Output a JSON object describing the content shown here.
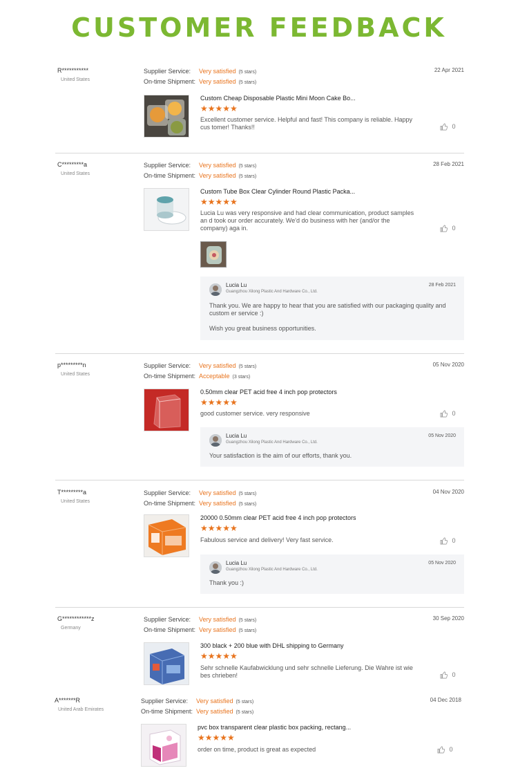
{
  "page_title": "CUSTOMER FEEDBACK",
  "labels": {
    "supplier_service": "Supplier Service:",
    "ontime_shipment": "On-time Shipment:"
  },
  "colors": {
    "title": "#7cb832",
    "accent": "#e8741e"
  },
  "reviews": [
    {
      "name": "R***********",
      "country": "United States",
      "date": "22 Apr 2021",
      "supplier_value": "Very satisfied",
      "supplier_stars": "(5 stars)",
      "shipment_value": "Very satisfied",
      "shipment_stars": "(5 stars)",
      "product": "Custom Cheap Disposable Plastic Mini Moon Cake Bo...",
      "rating": "★★★★★",
      "comment": "Excellent customer service. Helpful and fast! This company is reliable. Happy cus tomer! Thanks!!",
      "likes": "0"
    },
    {
      "name": "C*********a",
      "country": "United States",
      "date": "28 Feb 2021",
      "supplier_value": "Very satisfied",
      "supplier_stars": "(5 stars)",
      "shipment_value": "Very satisfied",
      "shipment_stars": "(5 stars)",
      "product": "Custom Tube Box Clear Cylinder Round Plastic Packa...",
      "rating": "★★★★★",
      "comment": "Lucia Lu was very responsive and had clear communication, product samples an d took our order accurately.  We'd do business with her (and/or the company) aga in.",
      "likes": "0",
      "reply": {
        "name": "Lucia Lu",
        "company": "Guangzhou Xilong Plastic And Hardware Co., Ltd.",
        "date": "28 Feb 2021",
        "text1": "Thank you.  We are happy to hear that you are satisfied with our packaging quality and custom er service  :)",
        "text2": "Wish you great business opportunities."
      }
    },
    {
      "name": "p*********n",
      "country": "United States",
      "date": "05 Nov 2020",
      "supplier_value": "Very satisfied",
      "supplier_stars": "(5 stars)",
      "shipment_value": "Acceptable",
      "shipment_stars": "(3 stars)",
      "product": "0.50mm clear PET acid free 4 inch pop protectors",
      "rating": "★★★★★",
      "comment": "good customer service.  very responsive",
      "likes": "0",
      "reply": {
        "name": "Lucia Lu",
        "company": "Guangzhou Xilong Plastic And Hardware Co., Ltd.",
        "date": "05 Nov 2020",
        "text1": "Your satisfaction is the aim of our efforts, thank you."
      }
    },
    {
      "name": "T*********a",
      "country": "United States",
      "date": "04 Nov 2020",
      "supplier_value": "Very satisfied",
      "supplier_stars": "(5 stars)",
      "shipment_value": "Very satisfied",
      "shipment_stars": "(5 stars)",
      "product": "20000 0.50mm clear PET acid free 4 inch pop protectors",
      "rating": "★★★★★",
      "comment": "Fabulous service and delivery!  Very fast service.",
      "likes": "0",
      "reply": {
        "name": "Lucia Lu",
        "company": "Guangzhou Xilong Plastic And Hardware Co., Ltd.",
        "date": "05 Nov 2020",
        "text1": "Thank you :)"
      }
    },
    {
      "name": "G************z",
      "country": "Germany",
      "date": "30 Sep 2020",
      "supplier_value": "Very satisfied",
      "supplier_stars": "(5 stars)",
      "shipment_value": "Very satisfied",
      "shipment_stars": "(5 stars)",
      "product": "300 black + 200 blue with DHL shipping to Germany",
      "rating": "★★★★★",
      "comment": "Sehr schnelle Kaufabwicklung und sehr schnelle Lieferung. Die Wahre ist wie bes chrieben!",
      "likes": "0"
    },
    {
      "name": "A*******R",
      "country": "United Arab Emirates",
      "date": "04 Dec 2018",
      "supplier_value": "Very satisfied",
      "supplier_stars": "(5 stars)",
      "shipment_value": "Very satisfied",
      "shipment_stars": "(5 stars)",
      "product": "pvc box transparent clear plastic box packing, rectang...",
      "rating": "★★★★★",
      "comment": "order on time, product is great as expected",
      "likes": "0"
    }
  ]
}
